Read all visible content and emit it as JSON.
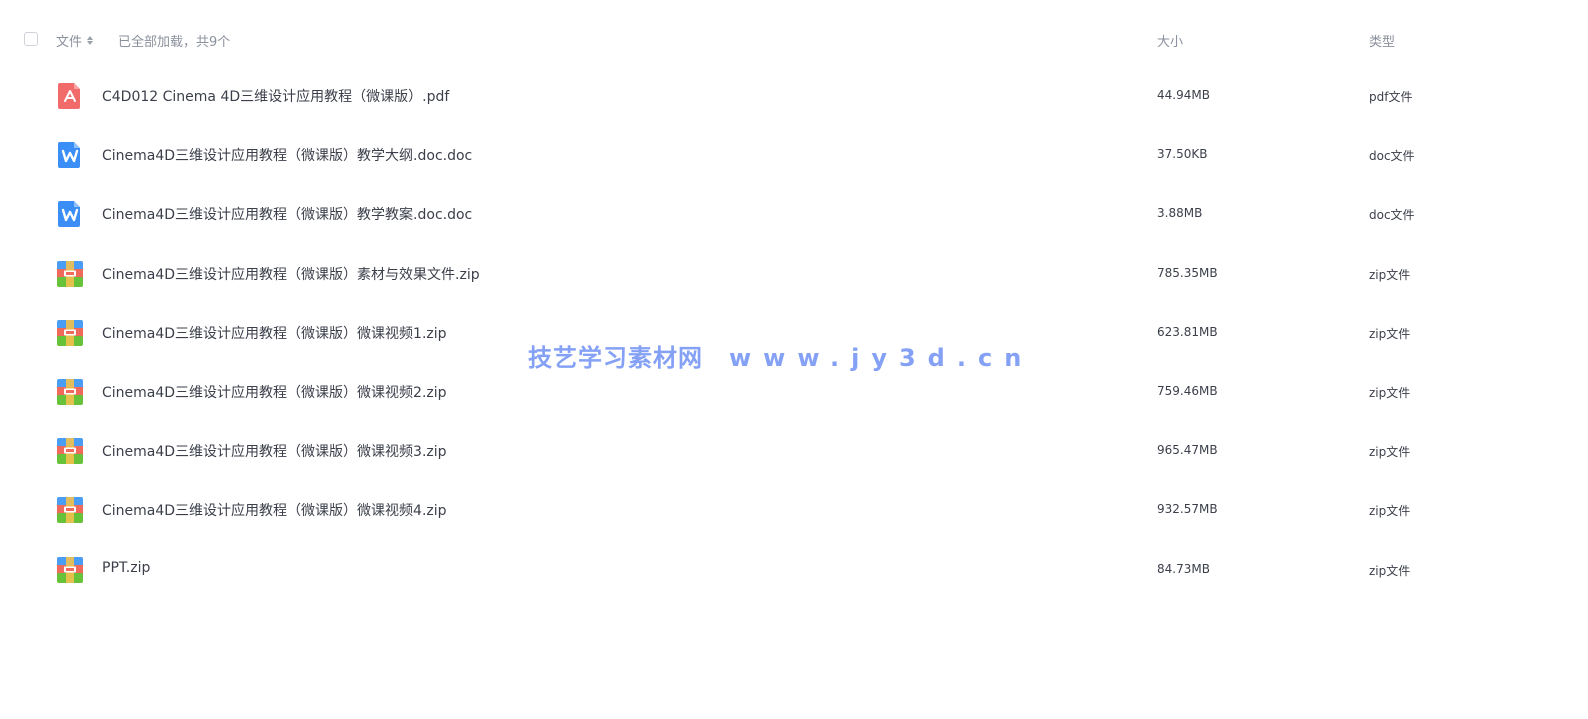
{
  "header": {
    "file_label": "文件",
    "status_text": "已全部加载，共9个",
    "size_label": "大小",
    "type_label": "类型"
  },
  "files": [
    {
      "name": "C4D012 Cinema 4D三维设计应用教程（微课版）.pdf",
      "size": "44.94MB",
      "type": "pdf文件",
      "icon": "pdf-icon"
    },
    {
      "name": "Cinema4D三维设计应用教程（微课版）教学大纲.doc.doc",
      "size": "37.50KB",
      "type": "doc文件",
      "icon": "word-doc-icon"
    },
    {
      "name": "Cinema4D三维设计应用教程（微课版）教学教案.doc.doc",
      "size": "3.88MB",
      "type": "doc文件",
      "icon": "word-doc-icon"
    },
    {
      "name": "Cinema4D三维设计应用教程（微课版）素材与效果文件.zip",
      "size": "785.35MB",
      "type": "zip文件",
      "icon": "zip-archive-icon"
    },
    {
      "name": "Cinema4D三维设计应用教程（微课版）微课视频1.zip",
      "size": "623.81MB",
      "type": "zip文件",
      "icon": "zip-archive-icon"
    },
    {
      "name": "Cinema4D三维设计应用教程（微课版）微课视频2.zip",
      "size": "759.46MB",
      "type": "zip文件",
      "icon": "zip-archive-icon"
    },
    {
      "name": "Cinema4D三维设计应用教程（微课版）微课视频3.zip",
      "size": "965.47MB",
      "type": "zip文件",
      "icon": "zip-archive-icon"
    },
    {
      "name": "Cinema4D三维设计应用教程（微课版）微课视频4.zip",
      "size": "932.57MB",
      "type": "zip文件",
      "icon": "zip-archive-icon"
    },
    {
      "name": "PPT.zip",
      "size": "84.73MB",
      "type": "zip文件",
      "icon": "zip-archive-icon"
    }
  ],
  "watermark": {
    "site_name": "技艺学习素材网",
    "url": "www.jy3d.cn"
  },
  "colors": {
    "pdf": "#f26b6b",
    "word": "#3a8ef6",
    "zip_top": "#4a9df5",
    "zip_mid": "#ef6a5a",
    "zip_bottom": "#67c23a",
    "text": "#3b3f4a",
    "header_text": "#8a909c",
    "watermark": "#7f9cf5"
  }
}
